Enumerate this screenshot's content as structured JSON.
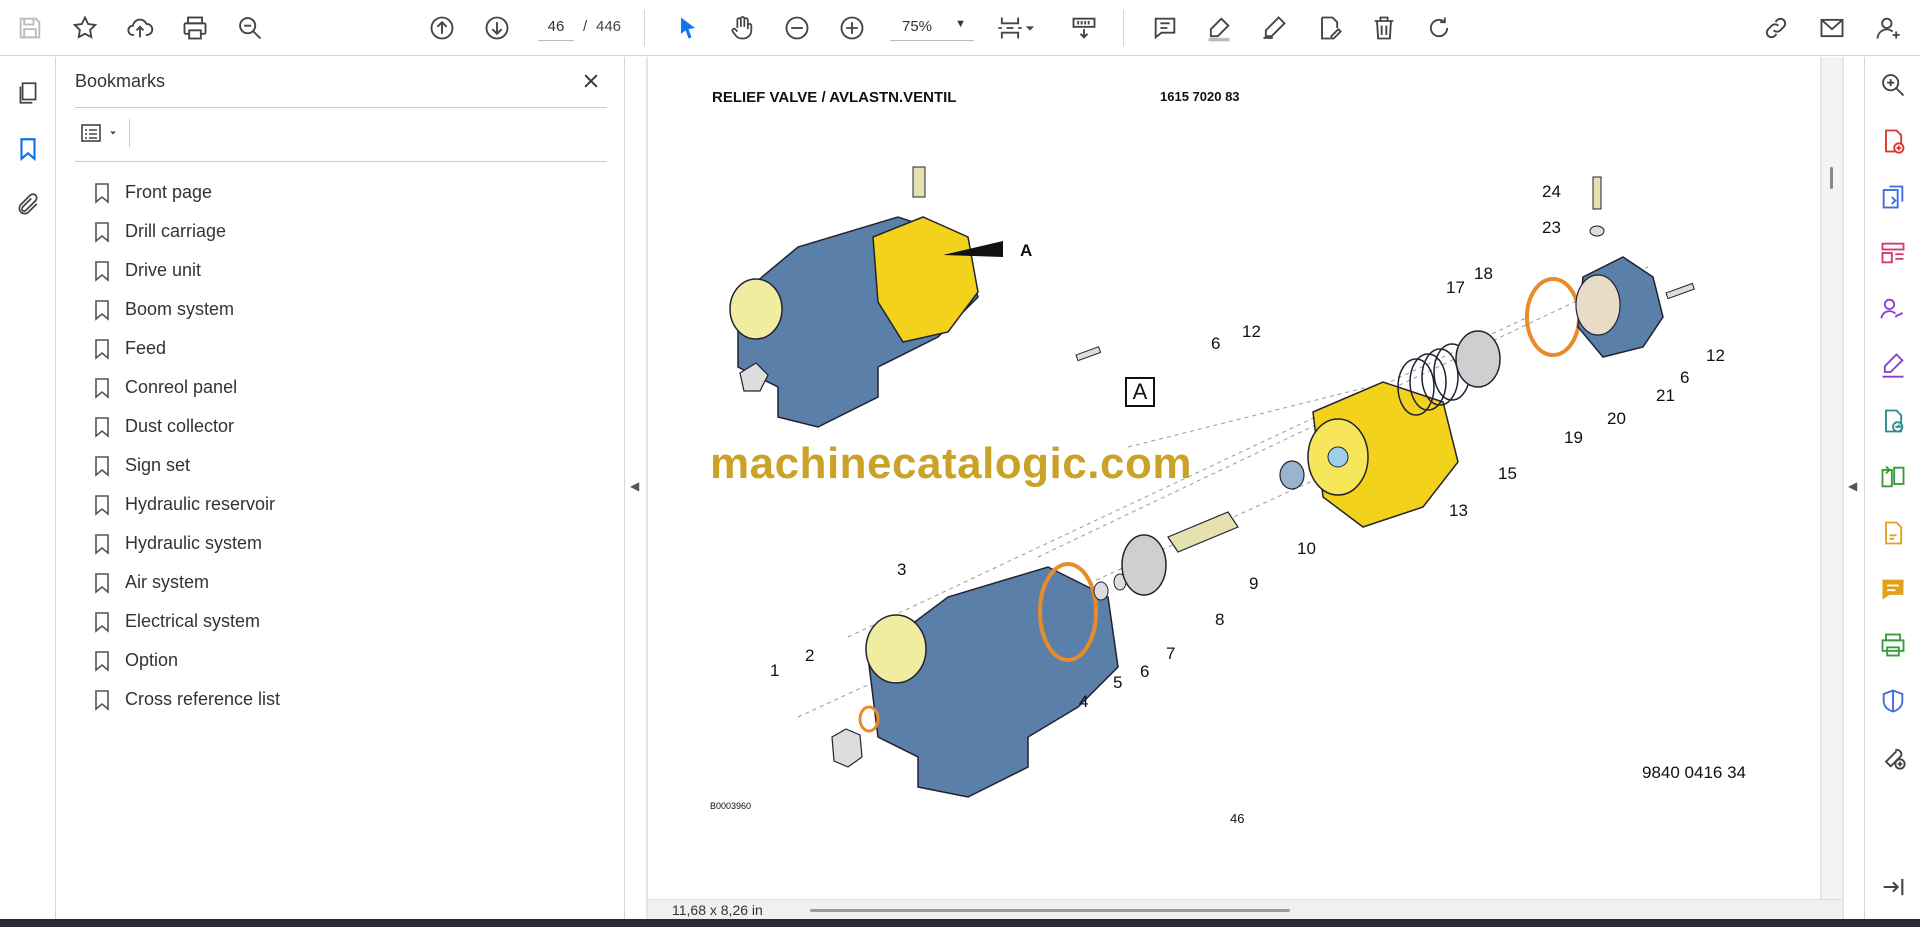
{
  "toolbar": {
    "page_current": "46",
    "page_separator": "/",
    "page_total": "446",
    "zoom_value": "75%",
    "icons": [
      "save-icon",
      "star-icon",
      "cloud-upload-icon",
      "print-icon",
      "find-icon",
      "page-up-icon",
      "page-down-icon",
      "select-cursor-icon",
      "hand-icon",
      "zoom-out-icon",
      "zoom-in-icon",
      "page-fit-icon",
      "scroll-mode-icon",
      "comment-icon",
      "highlight-icon",
      "draw-icon",
      "edit-text-icon",
      "delete-icon",
      "rotate-icon",
      "share-link-icon",
      "email-icon",
      "account-icon"
    ]
  },
  "bookmarks": {
    "title": "Bookmarks",
    "items": [
      {
        "label": "Front page"
      },
      {
        "label": "Drill carriage"
      },
      {
        "label": "Drive unit"
      },
      {
        "label": "Boom system"
      },
      {
        "label": "Feed"
      },
      {
        "label": "Conreol panel"
      },
      {
        "label": "Dust collector"
      },
      {
        "label": "Sign set"
      },
      {
        "label": "Hydraulic reservoir"
      },
      {
        "label": "Hydraulic system"
      },
      {
        "label": "Air system"
      },
      {
        "label": "Electrical system"
      },
      {
        "label": "Option"
      },
      {
        "label": "Cross reference list"
      }
    ]
  },
  "document": {
    "title": "RELIEF VALVE / AVLASTN.VENTIL",
    "code": "1615 7020 83",
    "watermark": "machinecatalogic.com",
    "box_label": "A",
    "arrow_label": "A",
    "part_number": "9840 0416 34",
    "bottom_code": "B0003960",
    "page_number": "46",
    "callouts": [
      "1",
      "2",
      "3",
      "4",
      "5",
      "6",
      "7",
      "8",
      "9",
      "10",
      "12",
      "13",
      "15",
      "17",
      "18",
      "19",
      "20",
      "21",
      "23",
      "24",
      "6",
      "12",
      "6",
      "12"
    ]
  },
  "status": {
    "page_size": "11,68 x 8,26 in"
  },
  "colors": {
    "accent_blue": "#1473e6",
    "part_blue": "#5a7fa8",
    "part_yellow": "#f2d21b",
    "gasket_orange": "#e88b2a",
    "watermark": "#c9a227"
  }
}
